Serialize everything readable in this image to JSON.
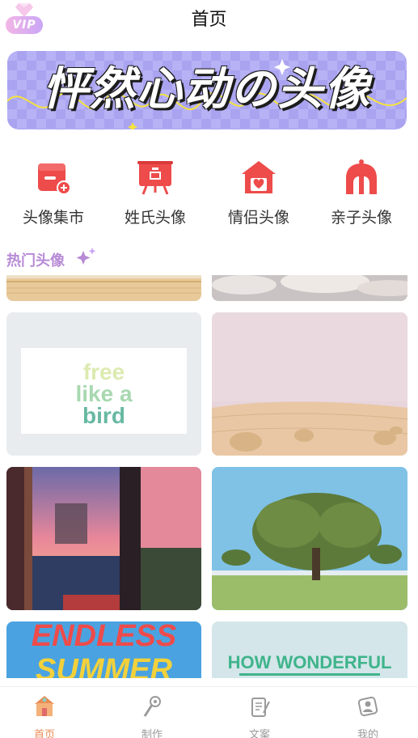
{
  "header": {
    "vip_label": "VIP",
    "title": "首页"
  },
  "banner": {
    "title": "怦然心动の头像"
  },
  "categories": [
    {
      "label": "头像集市",
      "icon": "market-shop-icon"
    },
    {
      "label": "姓氏头像",
      "icon": "surname-board-icon"
    },
    {
      "label": "情侣头像",
      "icon": "couple-house-heart-icon"
    },
    {
      "label": "亲子头像",
      "icon": "parent-child-icon"
    }
  ],
  "hot": {
    "title": "热门头像"
  },
  "tiles": [
    {
      "caption": ""
    },
    {
      "caption": ""
    },
    {
      "caption": "free like a bird",
      "lines": [
        "free",
        "like a",
        "bird"
      ]
    },
    {
      "caption": ""
    },
    {
      "caption": ""
    },
    {
      "caption": ""
    },
    {
      "caption": "ENDLESS SUMMER",
      "lines": [
        "ENDLESS",
        "SUMMER"
      ]
    },
    {
      "caption": "HOW WONDERFUL"
    }
  ],
  "tabbar": {
    "items": [
      {
        "label": "首页",
        "icon": "home-house-icon",
        "active": true
      },
      {
        "label": "制作",
        "icon": "make-tool-icon",
        "active": false
      },
      {
        "label": "文案",
        "icon": "copywriting-note-icon",
        "active": false
      },
      {
        "label": "我的",
        "icon": "profile-icon",
        "active": false
      }
    ]
  },
  "colors": {
    "accent_red": "#ee4b4b",
    "section_purple": "#b78ad6",
    "tab_active": "#e98a52",
    "tab_inactive": "#999999",
    "banner_bg": "#b7b2f5"
  }
}
